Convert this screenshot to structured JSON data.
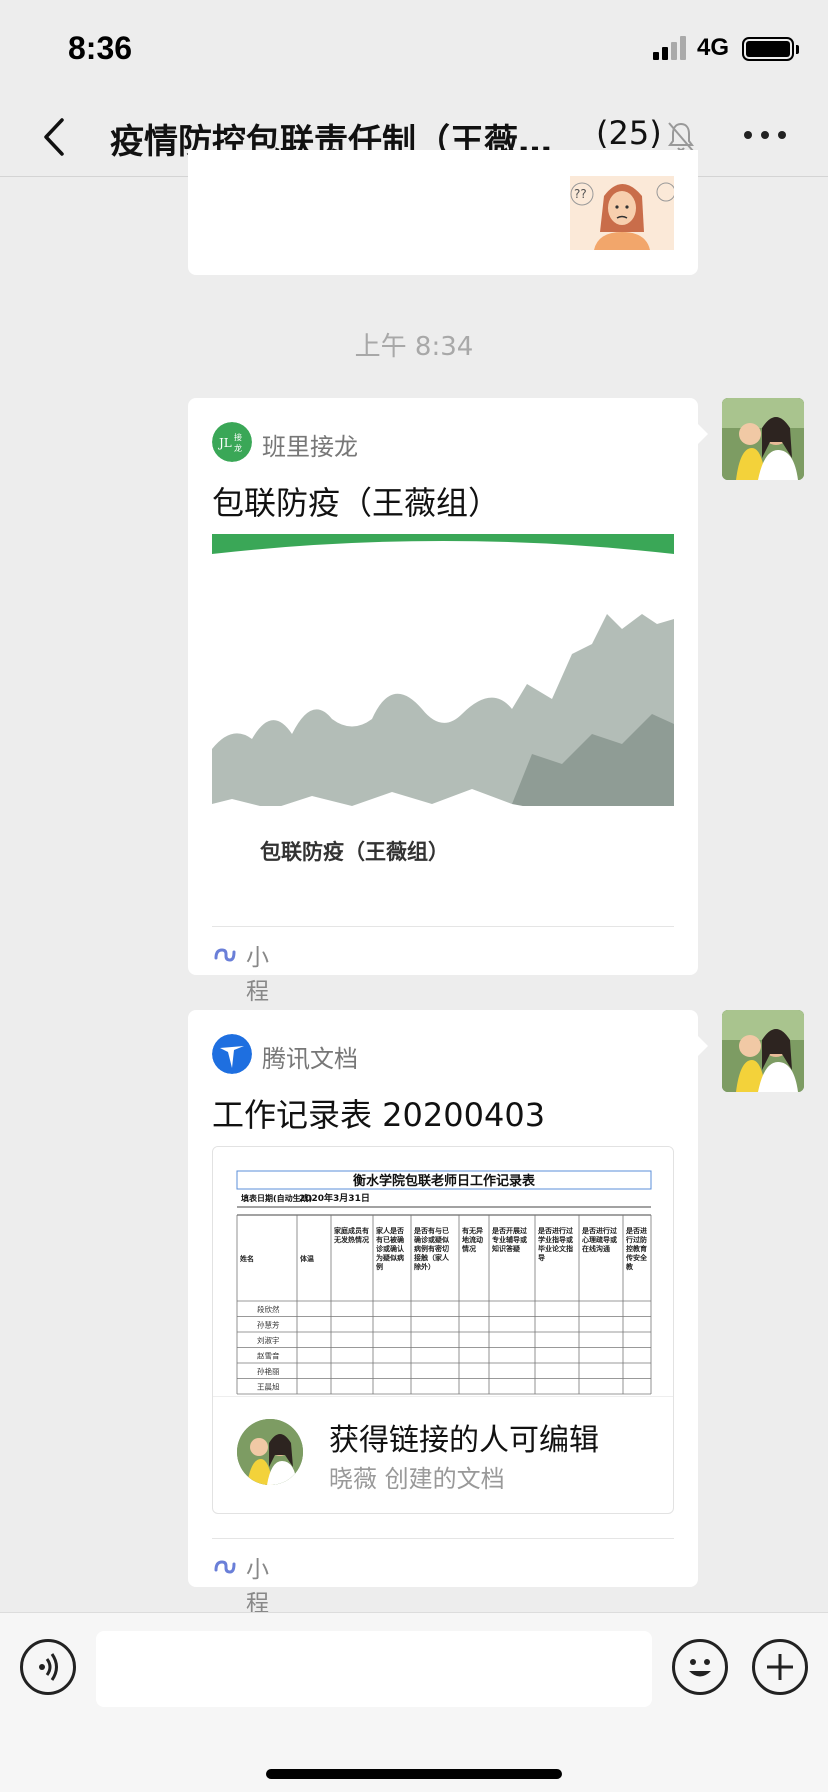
{
  "status_bar": {
    "time": "8:36",
    "network": "4G"
  },
  "nav": {
    "title": "疫情防控包联责任制（王薇…",
    "member_count": "(25)"
  },
  "messages": {
    "timestamp": "上午 8:34",
    "mini_program_card": {
      "app_name": "班里接龙",
      "logo_text": "JL接龙",
      "title": "包联防疫（王薇组）",
      "cover_caption": "包联防疫（王薇组）",
      "footer_label": "小程序"
    },
    "doc_card": {
      "app_name": "腾讯文档",
      "title": "工作记录表 20200403",
      "preview": {
        "sheet_title": "衡水学院包联老师日工作记录表",
        "date_label": "填表日期(自动生成)",
        "date_value": "2020年3月31日",
        "columns": [
          "姓名",
          "体温",
          "家庭成员有无发热情况",
          "家人是否有已被确诊或确认为疑似病例",
          "是否有与已确诊或疑似病例有密切接触（家人除外）",
          "有无异地流动情况",
          "是否开展过专业辅导或知识答疑",
          "是否进行过学业指导或毕业论文指导",
          "是否进行过心理疏导或在线沟通",
          "是否进行过防控教育传安全教"
        ],
        "rows": [
          "段欣然",
          "孙慧芳",
          "刘淑宇",
          "赵雪音",
          "孙艳丽",
          "王晨旭"
        ]
      },
      "permission": "获得链接的人可编辑",
      "creator": "晓薇 创建的文档",
      "footer_label": "小程序"
    }
  },
  "input": {
    "placeholder": ""
  },
  "colors": {
    "accent_green": "#3aa757",
    "tencent_blue": "#1e6fe0",
    "background": "#ededed"
  }
}
